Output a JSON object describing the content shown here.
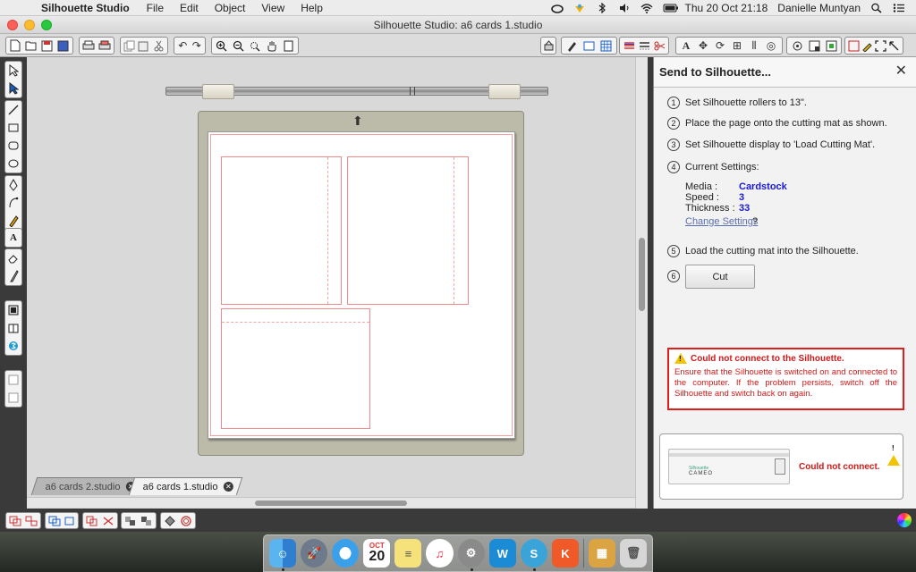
{
  "menubar": {
    "apple_icon": "apple-icon",
    "app_name": "Silhouette Studio",
    "menus": [
      "File",
      "Edit",
      "Object",
      "View",
      "Help"
    ],
    "datetime": "Thu 20 Oct  21:18",
    "user": "Danielle Muntyan"
  },
  "window": {
    "title": "Silhouette Studio: a6 cards 1.studio"
  },
  "tabs": [
    {
      "label": "a6 cards 2.studio",
      "active": false
    },
    {
      "label": "a6 cards 1.studio",
      "active": true
    }
  ],
  "panel": {
    "title": "Send to Silhouette...",
    "steps": [
      {
        "num": "1",
        "text": "Set Silhouette rollers to 13\"."
      },
      {
        "num": "2",
        "text": "Place the page onto the cutting mat as shown."
      },
      {
        "num": "3",
        "text": "Set Silhouette display to 'Load Cutting Mat'."
      },
      {
        "num": "4",
        "text": "Current Settings:"
      },
      {
        "num": "5",
        "text": "Load the cutting mat into the Silhouette."
      },
      {
        "num": "6",
        "text": ""
      }
    ],
    "settings": {
      "media_label": "Media :",
      "media_value": "Cardstock",
      "speed_label": "Speed :",
      "speed_value": "3",
      "thickness_label": "Thickness :",
      "thickness_value": "33"
    },
    "change_settings": "Change Settings",
    "change_settings_suffix": "?",
    "cut_label": "Cut",
    "error": {
      "title": "Could not connect to the Silhouette.",
      "body": "Ensure that the Silhouette is switched on and connected to the computer. If the problem persists, switch off the Silhouette and switch back on again."
    },
    "status": {
      "machine_brand": "Silhouette",
      "machine_model": "CAMEO",
      "text": "Could not connect."
    }
  },
  "dock": {
    "calendar_month": "OCT",
    "calendar_day": "20"
  },
  "colors": {
    "accent_blue": "#1a1ad6",
    "error_red": "#d01818",
    "cut_line": "#f08a8a",
    "mat": "#bcbaa9"
  }
}
